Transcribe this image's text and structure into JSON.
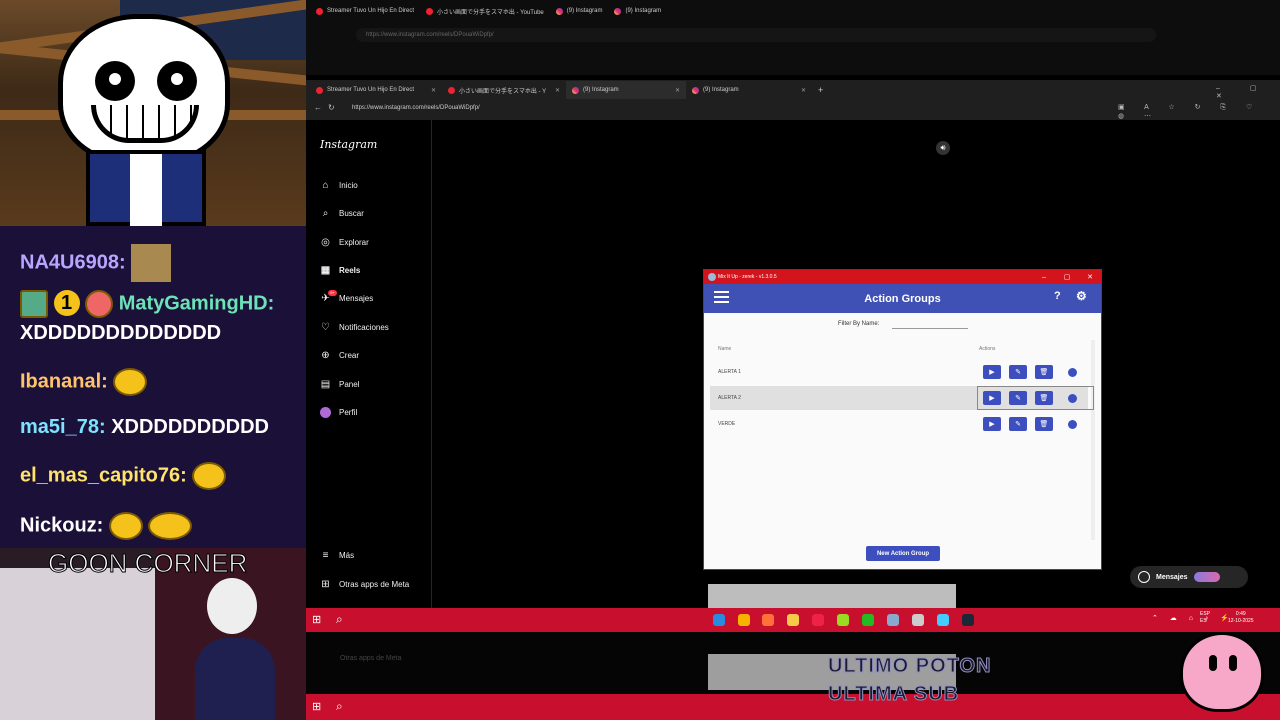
{
  "chat": {
    "lines": [
      {
        "user": "NA4U6908:",
        "text": ""
      },
      {
        "user": "MatyGamingHD:",
        "text": "XDDDDDDDDDDDDD",
        "badge": "1"
      },
      {
        "user": "Ibananal:",
        "text": ""
      },
      {
        "user": "ma5i_78:",
        "text": "XDDDDDDDDDD"
      },
      {
        "user": "el_mas_capito76:",
        "text": ""
      },
      {
        "user": "Nickouz:",
        "text": ""
      }
    ]
  },
  "overlay": {
    "goon_corner": "GOON CORNER",
    "ultimo_1": "ULTIMO POTON",
    "ultimo_2": "ULTIMA SUB"
  },
  "browser_back": {
    "tabs": [
      {
        "label": "Streamer Tuvo Un Hijo En Direct"
      },
      {
        "label": "小さい画面で分手をスマホ出 - YouTube"
      },
      {
        "label": "(9) Instagram"
      },
      {
        "label": "(9) Instagram"
      }
    ],
    "url": "https://www.instagram.com/reels/DPouaWiDpfp/"
  },
  "browser": {
    "tabs": [
      {
        "label": "Streamer Tuvo Un Hijo En Direct"
      },
      {
        "label": "小さい画面で分手をスマホ出 - Y"
      },
      {
        "label": "(9) Instagram"
      },
      {
        "label": "(9) Instagram"
      }
    ],
    "new_tab": "+",
    "url": "https://www.instagram.com/reels/DPouaWiDpfp/"
  },
  "instagram": {
    "logo": "Instagram",
    "nav": [
      {
        "label": "Inicio",
        "icon": "home-icon"
      },
      {
        "label": "Buscar",
        "icon": "search-icon"
      },
      {
        "label": "Explorar",
        "icon": "compass-icon"
      },
      {
        "label": "Reels",
        "icon": "reels-icon"
      },
      {
        "label": "Mensajes",
        "icon": "messages-icon"
      },
      {
        "label": "Notificaciones",
        "icon": "heart-icon"
      },
      {
        "label": "Crear",
        "icon": "plus-icon"
      },
      {
        "label": "Panel",
        "icon": "chart-icon"
      },
      {
        "label": "Perfil",
        "icon": "avatar-icon"
      }
    ],
    "more": "Más",
    "meta_apps": "Otras apps de Meta",
    "messages_button": "Mensajes",
    "messages_badge": "9+"
  },
  "dialog": {
    "window_title": "Mix It Up - zerek - v1.3.0.5",
    "header": "Action Groups",
    "filter_label": "Filter By Name:",
    "col_name": "Name",
    "col_actions": "Actions",
    "rows": [
      {
        "name": "ALERTA 1"
      },
      {
        "name": "ALERTA 2"
      },
      {
        "name": "VERDE"
      }
    ],
    "new_button": "New Action Group"
  },
  "taskbar": {
    "lang": "ESP\nES",
    "time": "0:49",
    "date": "12-10-2025"
  },
  "colors": {
    "accent": "#3f51b5",
    "titlebar": "#d4141c",
    "taskbar": "#c8102e"
  }
}
